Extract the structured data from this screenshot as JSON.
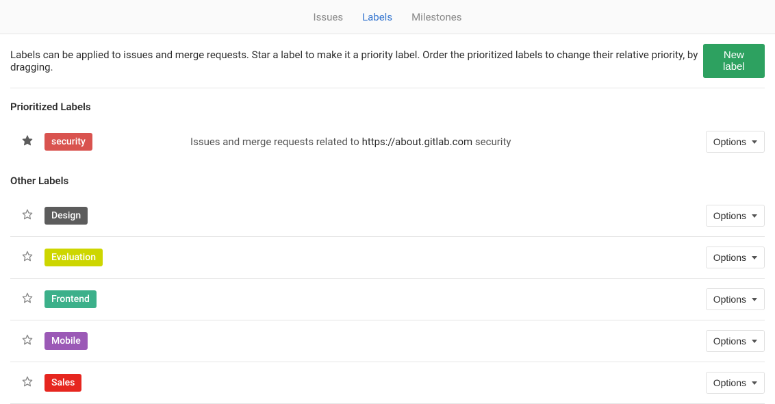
{
  "tabs": {
    "issues": "Issues",
    "labels": "Labels",
    "milestones": "Milestones"
  },
  "header": {
    "help_text": "Labels can be applied to issues and merge requests. Star a label to make it a priority label. Order the prioritized labels to change their relative priority, by dragging.",
    "new_label_button": "New label"
  },
  "sections": {
    "prioritized_heading": "Prioritized Labels",
    "other_heading": "Other Labels"
  },
  "prioritized": [
    {
      "name": "security",
      "color": "#d9534f",
      "starred": true,
      "description_pre": "Issues and merge requests related to ",
      "description_link": "https://about.gitlab.com",
      "description_post": " security"
    }
  ],
  "other": [
    {
      "name": "Design",
      "color": "#5c5c5c",
      "starred": false
    },
    {
      "name": "Evaluation",
      "color": "#cdd600",
      "starred": false
    },
    {
      "name": "Frontend",
      "color": "#3cb08a",
      "starred": false
    },
    {
      "name": "Mobile",
      "color": "#9b59b6",
      "starred": false
    },
    {
      "name": "Sales",
      "color": "#e6261f",
      "starred": false
    }
  ],
  "options_button": "Options"
}
